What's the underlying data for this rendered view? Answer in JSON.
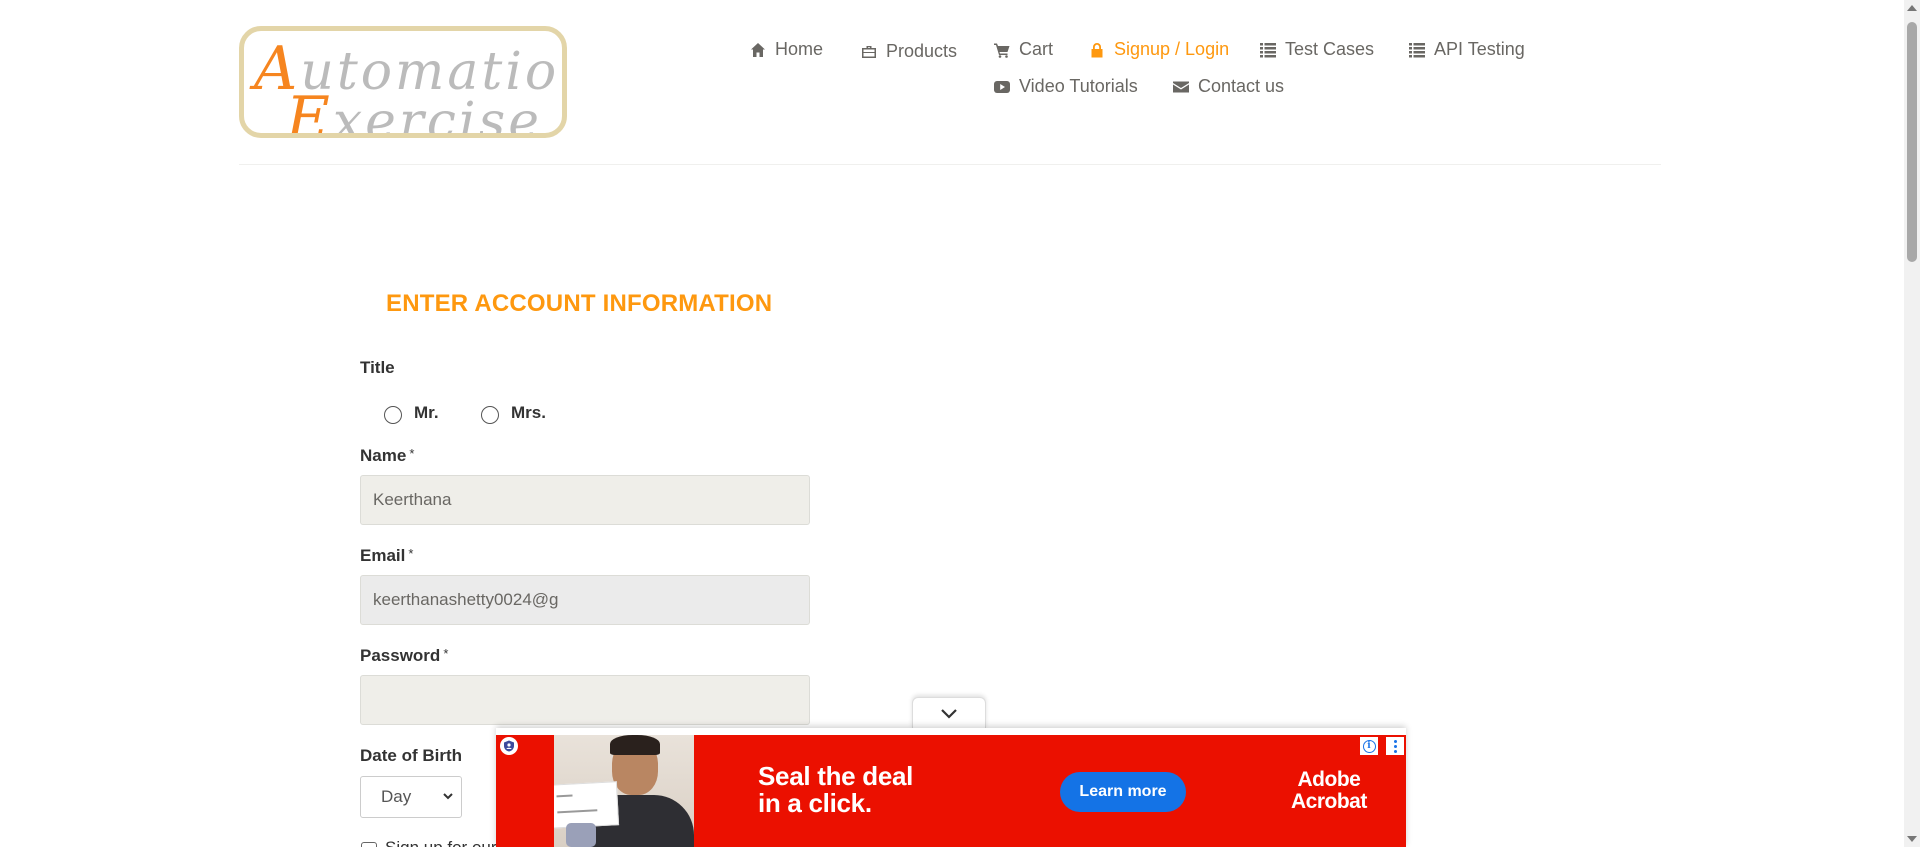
{
  "logo": {
    "line1_cap": "A",
    "line1_rest": "utomation",
    "line2_cap": "E",
    "line2_rest": "xercise"
  },
  "nav": {
    "items": [
      {
        "label": "Home",
        "icon": "home-icon"
      },
      {
        "label": "Products",
        "icon": "briefcase-icon"
      },
      {
        "label": "Cart",
        "icon": "cart-icon"
      },
      {
        "label": "Signup / Login",
        "icon": "lock-icon",
        "active": true
      },
      {
        "label": "Test Cases",
        "icon": "list-icon"
      },
      {
        "label": "API Testing",
        "icon": "list-icon"
      },
      {
        "label": "Video Tutorials",
        "icon": "youtube-icon"
      },
      {
        "label": "Contact us",
        "icon": "envelope-icon"
      }
    ]
  },
  "form": {
    "title": "ENTER ACCOUNT INFORMATION",
    "title_label": "Title",
    "radio_mr": "Mr.",
    "radio_mrs": "Mrs.",
    "name_label": "Name",
    "name_value": "Keerthana",
    "email_label": "Email",
    "email_value": "keerthanashetty0024@g",
    "password_label": "Password",
    "password_value": "",
    "required_mark": "*",
    "dob_label": "Date of Birth",
    "dob_day": "Day",
    "newsletter_label": "Sign up for our newsletter!"
  },
  "ad": {
    "headline_line1": "Seal the deal",
    "headline_line2": "in a click.",
    "cta": "Learn more",
    "brand_line1": "Adobe",
    "brand_line2": "Acrobat",
    "info": "i"
  },
  "colors": {
    "accent": "#fe980f",
    "text": "#696763",
    "ad_background": "#eb1000",
    "ad_button": "#1473e6"
  }
}
